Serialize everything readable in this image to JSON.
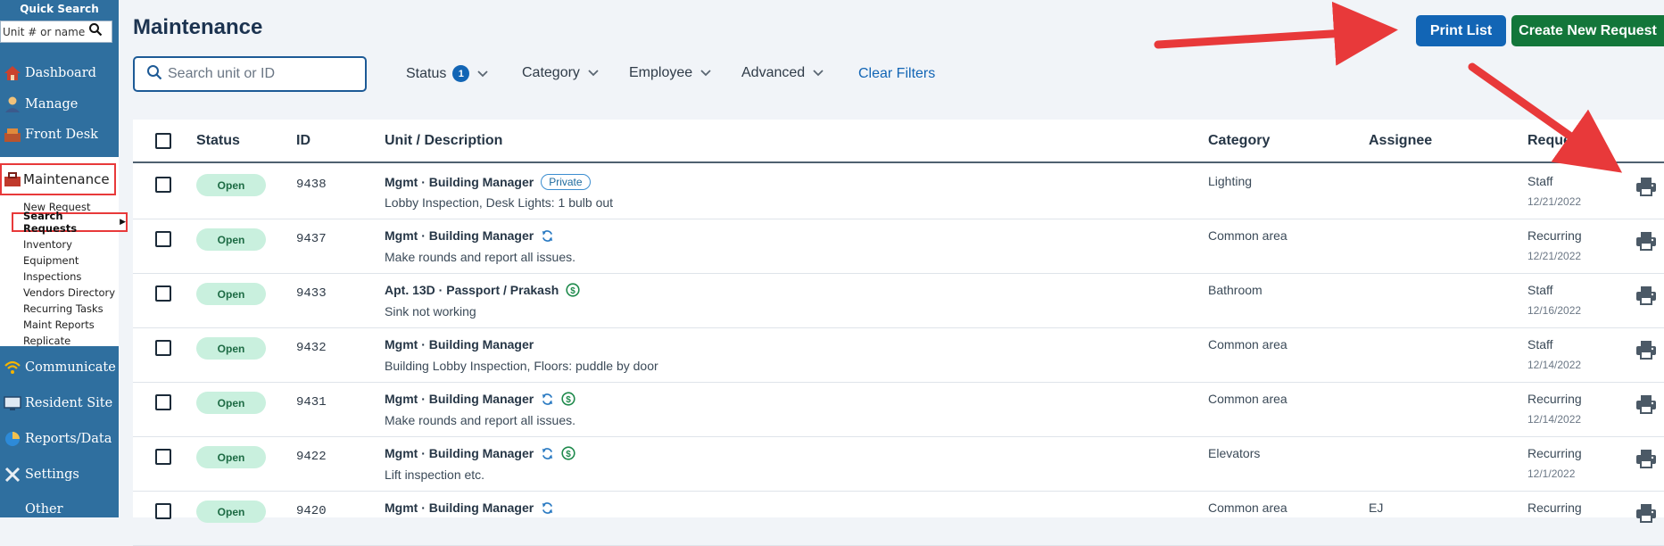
{
  "sidebar": {
    "quick_search_title": "Quick Search",
    "quick_search_placeholder": "Unit # or name",
    "nav": [
      {
        "label": "Dashboard",
        "icon": "dashboard-icon"
      },
      {
        "label": "Manage",
        "icon": "manage-icon"
      },
      {
        "label": "Front Desk",
        "icon": "front-desk-icon"
      },
      {
        "label": "Communicate",
        "icon": "communicate-icon"
      },
      {
        "label": "Resident Site",
        "icon": "resident-site-icon"
      },
      {
        "label": "Reports/Data",
        "icon": "reports-icon"
      },
      {
        "label": "Settings",
        "icon": "settings-icon"
      },
      {
        "label": "Other",
        "icon": "other-icon"
      }
    ],
    "maintenance": {
      "label": "Maintenance",
      "items": [
        "New Request",
        "Search Requests",
        "Inventory",
        "Equipment",
        "Inspections",
        "Vendors Directory",
        "Recurring Tasks",
        "Maint Reports",
        "Replicate"
      ],
      "active_index": 1
    }
  },
  "header": {
    "title": "Maintenance",
    "print_list_label": "Print List",
    "create_request_label": "Create New Request"
  },
  "filters": {
    "search_placeholder": "Search unit or ID",
    "status_label": "Status",
    "status_count": "1",
    "category_label": "Category",
    "employee_label": "Employee",
    "advanced_label": "Advanced",
    "clear_label": "Clear Filters"
  },
  "table": {
    "columns": [
      "Status",
      "ID",
      "Unit / Description",
      "Category",
      "Assignee",
      "Requested"
    ],
    "rows": [
      {
        "status": "Open",
        "id": "9438",
        "unit": "Mgmt · Building Manager",
        "tag": "Private",
        "recurring": false,
        "paid": false,
        "description": "Lobby Inspection, Desk Lights: 1 bulb out",
        "category": "Lighting",
        "assignee": "",
        "requested_by": "Staff",
        "date": "12/21/2022"
      },
      {
        "status": "Open",
        "id": "9437",
        "unit": "Mgmt · Building Manager",
        "tag": "",
        "recurring": true,
        "paid": false,
        "description": "Make rounds and report all issues.",
        "category": "Common area",
        "assignee": "",
        "requested_by": "Recurring",
        "date": "12/21/2022"
      },
      {
        "status": "Open",
        "id": "9433",
        "unit": "Apt. 13D · Passport / Prakash",
        "tag": "",
        "recurring": false,
        "paid": true,
        "description": "Sink not working",
        "category": "Bathroom",
        "assignee": "",
        "requested_by": "Staff",
        "date": "12/16/2022"
      },
      {
        "status": "Open",
        "id": "9432",
        "unit": "Mgmt · Building Manager",
        "tag": "",
        "recurring": false,
        "paid": false,
        "description": "Building Lobby Inspection, Floors: puddle by door",
        "category": "Common area",
        "assignee": "",
        "requested_by": "Staff",
        "date": "12/14/2022"
      },
      {
        "status": "Open",
        "id": "9431",
        "unit": "Mgmt · Building Manager",
        "tag": "",
        "recurring": true,
        "paid": true,
        "description": "Make rounds and report all issues.",
        "category": "Common area",
        "assignee": "",
        "requested_by": "Recurring",
        "date": "12/14/2022"
      },
      {
        "status": "Open",
        "id": "9422",
        "unit": "Mgmt · Building Manager",
        "tag": "",
        "recurring": true,
        "paid": true,
        "description": "Lift inspection etc.",
        "category": "Elevators",
        "assignee": "",
        "requested_by": "Recurring",
        "date": "12/1/2022"
      },
      {
        "status": "Open",
        "id": "9420",
        "unit": "Mgmt · Building Manager",
        "tag": "",
        "recurring": true,
        "paid": false,
        "description": "",
        "category": "Common area",
        "assignee": "EJ",
        "requested_by": "Recurring",
        "date": ""
      }
    ]
  },
  "colors": {
    "sidebar": "#2f6f9f",
    "primary_blue": "#1265b5",
    "success_green": "#13763a",
    "status_open_bg": "#c9f0de",
    "annotation_red": "#e8393a"
  }
}
